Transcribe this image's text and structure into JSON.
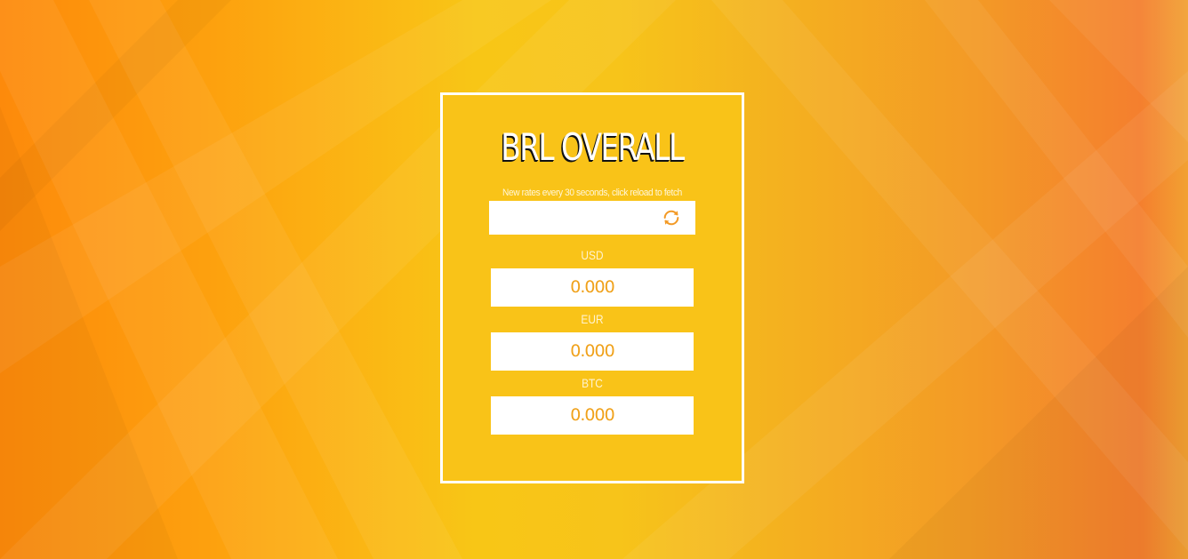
{
  "app": {
    "title": "BRL OVERALL",
    "subtitle": "New rates every 30 seconds, click reload to fetch"
  },
  "reload": {
    "icon": "refresh-icon",
    "icon_color": "#f39a26"
  },
  "currencies": [
    {
      "label": "USD",
      "value": "0.000"
    },
    {
      "label": "EUR",
      "value": "0.000"
    },
    {
      "label": "BTC",
      "value": "0.000"
    }
  ],
  "colors": {
    "card_background": "#f9c318",
    "border": "#ffffff",
    "value_text": "#f0a21c"
  }
}
